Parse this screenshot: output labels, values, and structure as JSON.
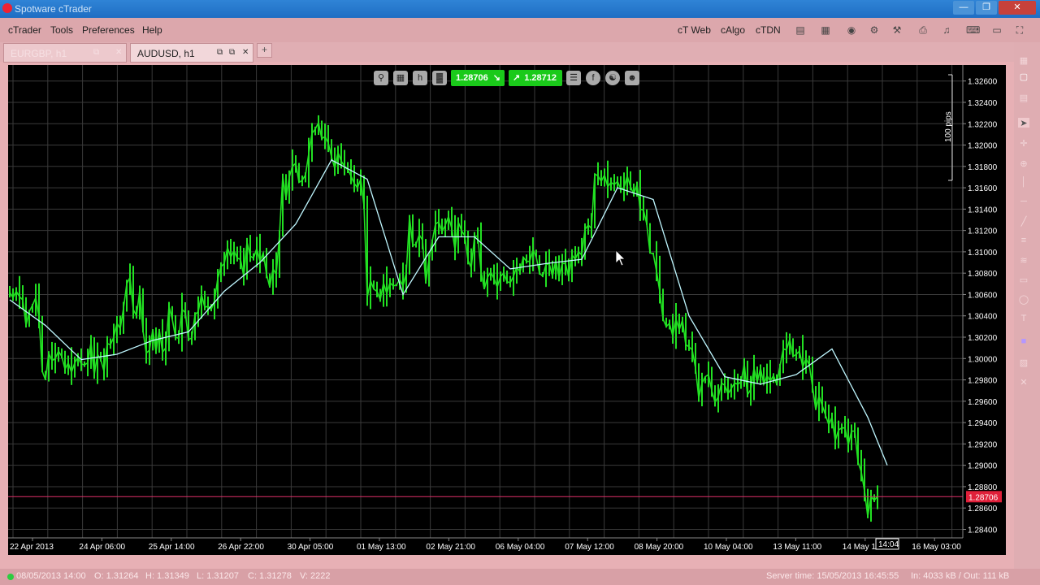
{
  "window": {
    "title": "Spotware cTrader"
  },
  "menu": {
    "items": [
      "cTrader",
      "Tools",
      "Preferences",
      "Help"
    ]
  },
  "toolbar": {
    "links": [
      "cT Web",
      "cAlgo",
      "cTDN"
    ]
  },
  "tabs": [
    {
      "label": "EURGBP, h1",
      "active": false
    },
    {
      "label": "AUDUSD, h1",
      "active": true
    }
  ],
  "chart_toolbar": {
    "timeframe": "h",
    "sell_price": "1.28706",
    "buy_price": "1.28712"
  },
  "chart_data": {
    "type": "line",
    "symbol": "AUDUSD",
    "timeframe": "h1",
    "y_ticks": [
      "1.32600",
      "1.32400",
      "1.32200",
      "1.32000",
      "1.31800",
      "1.31600",
      "1.31400",
      "1.31200",
      "1.31000",
      "1.30800",
      "1.30600",
      "1.30400",
      "1.30200",
      "1.30000",
      "1.29800",
      "1.29600",
      "1.29400",
      "1.29200",
      "1.29000",
      "1.28800",
      "1.28600",
      "1.28400"
    ],
    "ylim": [
      1.2832,
      1.3275
    ],
    "x_ticks": [
      "22 Apr 2013",
      "24 Apr 06:00",
      "25 Apr 14:00",
      "26 Apr 22:00",
      "30 Apr 05:00",
      "01 May 13:00",
      "02 May 21:00",
      "06 May 04:00",
      "07 May 12:00",
      "08 May 20:00",
      "10 May 04:00",
      "13 May 11:00",
      "14 May 19:00",
      "16 May 03:00"
    ],
    "current_price": "1.28706",
    "current_time": "14:04",
    "scale_label": "100 pips",
    "series": [
      {
        "type": "price",
        "x": [
          0,
          1,
          2,
          3,
          4,
          5,
          6,
          7,
          8,
          9,
          10,
          11,
          12,
          13,
          14,
          15,
          16,
          17,
          18,
          19,
          20,
          21,
          22,
          23,
          24,
          25,
          26,
          27,
          28,
          29,
          30,
          31,
          32,
          33,
          34,
          35,
          36,
          37,
          38,
          39,
          40,
          41,
          42,
          43,
          44,
          45,
          46,
          47,
          48,
          49,
          50,
          51,
          52,
          53,
          54,
          55,
          56,
          57,
          58,
          59,
          60,
          61,
          62,
          63,
          64,
          65,
          66,
          67,
          68,
          69,
          70,
          71,
          72,
          73,
          74,
          75,
          76,
          77,
          78,
          79,
          80,
          81,
          82,
          83,
          84,
          85,
          86,
          87,
          88,
          89,
          90,
          91,
          92,
          93,
          94,
          95,
          96,
          97,
          98,
          99,
          100,
          101,
          102,
          103,
          104,
          105,
          106,
          107,
          108,
          109,
          110,
          111,
          112,
          113,
          114,
          115,
          116,
          117,
          118,
          119,
          120,
          121,
          122,
          123,
          124,
          125,
          126,
          127,
          128,
          129,
          130,
          131,
          132,
          133,
          134,
          135,
          136,
          137,
          138,
          139,
          140,
          141,
          142,
          143,
          144,
          145,
          146,
          147,
          148,
          149,
          150,
          151,
          152,
          153,
          154,
          155,
          156,
          157,
          158,
          159,
          160,
          161,
          162,
          163,
          164,
          165,
          166,
          167,
          168,
          169,
          170,
          171,
          172,
          173,
          174,
          175,
          176,
          177,
          178,
          179,
          180,
          181,
          182,
          183,
          184,
          185,
          186,
          187,
          188,
          189,
          190,
          191,
          192,
          193,
          194,
          195,
          196,
          197,
          198,
          199,
          200,
          201,
          202,
          203,
          204,
          205,
          206,
          207,
          208,
          209,
          210,
          211,
          212,
          213,
          214,
          215,
          216,
          217,
          218,
          219,
          220,
          221,
          222,
          223,
          224,
          225,
          226,
          227,
          228,
          229,
          230,
          231,
          232,
          233,
          234,
          235,
          236,
          237,
          238,
          239,
          240,
          241,
          242,
          243,
          244,
          245,
          246,
          247,
          248,
          249,
          250,
          251,
          252,
          253,
          254,
          255,
          256,
          257,
          258,
          259,
          260,
          261,
          262,
          263,
          264,
          265,
          266,
          267,
          268,
          269,
          270
        ],
        "close": [
          1.3062,
          1.3057,
          1.3063,
          1.3058,
          1.3055,
          1.3031,
          1.3044,
          1.305,
          1.3057,
          1.3039,
          1.2988,
          1.298,
          1.3005,
          1.2998,
          1.3,
          1.3007,
          1.3002,
          1.299,
          1.2996,
          1.2987,
          1.2996,
          1.3001,
          1.2995,
          1.2994,
          1.2996,
          1.3015,
          1.2985,
          1.3004,
          1.2999,
          1.2988,
          1.3014,
          1.3013,
          1.302,
          1.3033,
          1.3028,
          1.3047,
          1.307,
          1.3076,
          1.3046,
          1.304,
          1.3064,
          1.3026,
          1.3005,
          1.3008,
          1.3027,
          1.3006,
          1.3027,
          1.3006,
          1.301,
          1.3049,
          1.3037,
          1.302,
          1.3019,
          1.3046,
          1.3043,
          1.3018,
          1.3019,
          1.3041,
          1.3044,
          1.306,
          1.3048,
          1.3049,
          1.3046,
          1.3054,
          1.3075,
          1.3086,
          1.3089,
          1.3104,
          1.3095,
          1.3101,
          1.3094,
          1.3093,
          1.3077,
          1.3109,
          1.3096,
          1.3094,
          1.3103,
          1.3091,
          1.3099,
          1.3079,
          1.3067,
          1.3084,
          1.3079,
          1.3116,
          1.3171,
          1.315,
          1.317,
          1.318,
          1.3183,
          1.3165,
          1.3167,
          1.3172,
          1.3192,
          1.3211,
          1.3215,
          1.3221,
          1.3206,
          1.3208,
          1.3202,
          1.3189,
          1.3178,
          1.3193,
          1.3185,
          1.318,
          1.3177,
          1.3171,
          1.3164,
          1.316,
          1.3168,
          1.3143,
          1.3057,
          1.3073,
          1.3065,
          1.3063,
          1.3055,
          1.3071,
          1.3061,
          1.3071,
          1.3068,
          1.3069,
          1.3074,
          1.3068,
          1.308,
          1.3133,
          1.3106,
          1.3107,
          1.3116,
          1.3111,
          1.3071,
          1.3093,
          1.311,
          1.3126,
          1.3128,
          1.3119,
          1.3125,
          1.3133,
          1.3122,
          1.3102,
          1.3128,
          1.312,
          1.3115,
          1.3092,
          1.3085,
          1.3114,
          1.3115,
          1.3082,
          1.3065,
          1.3076,
          1.3081,
          1.3075,
          1.3067,
          1.3077,
          1.308,
          1.3072,
          1.3071,
          1.3077,
          1.3086,
          1.3081,
          1.3095,
          1.3091,
          1.3091,
          1.3102,
          1.3095,
          1.308,
          1.3077,
          1.3088,
          1.3089,
          1.3077,
          1.3092,
          1.3076,
          1.3089,
          1.3089,
          1.3076,
          1.3097,
          1.3093,
          1.31,
          1.3097,
          1.3121,
          1.3125,
          1.3122,
          1.3173,
          1.3171,
          1.3166,
          1.3172,
          1.3161,
          1.3165,
          1.3163,
          1.3166,
          1.3159,
          1.316,
          1.3171,
          1.3161,
          1.3154,
          1.3163,
          1.314,
          1.3139,
          1.3126,
          1.3099,
          1.3098,
          1.3082,
          1.3063,
          1.3037,
          1.303,
          1.3033,
          1.3021,
          1.3037,
          1.3027,
          1.3036,
          1.3013,
          1.3011,
          1.3008,
          1.2991,
          1.2963,
          1.2977,
          1.2983,
          1.2985,
          1.297,
          1.2959,
          1.2964,
          1.2977,
          1.2975,
          1.2967,
          1.2972,
          1.2977,
          1.2976,
          1.2978,
          1.2995,
          1.2966,
          1.2971,
          1.2991,
          1.2978,
          1.2991,
          1.2976,
          1.2984,
          1.2979,
          1.2984,
          1.2976,
          1.2993,
          1.3009,
          1.3008,
          1.3018,
          1.3002,
          1.3004,
          1.3007,
          1.2992,
          1.3,
          1.2994,
          1.2974,
          1.2952,
          1.2965,
          1.2956,
          1.2947,
          1.2938,
          1.2945,
          1.2923,
          1.2933,
          1.2935,
          1.2935,
          1.2919,
          1.2932,
          1.2932,
          1.2903,
          1.2894,
          1.2876,
          1.2852,
          1.2871,
          1.2867,
          1.2871
        ]
      },
      {
        "type": "moving_average",
        "x": [
          0,
          11,
          22,
          33,
          44,
          55,
          66,
          77,
          88,
          99,
          110,
          121,
          132,
          143,
          154,
          165,
          176,
          187,
          198,
          209,
          220,
          231,
          242,
          253,
          264,
          270
        ],
        "y": [
          1.3055,
          1.3031,
          1.2999,
          1.3004,
          1.3017,
          1.3025,
          1.3063,
          1.309,
          1.3126,
          1.3186,
          1.3168,
          1.306,
          1.3114,
          1.3114,
          1.3084,
          1.3089,
          1.3093,
          1.316,
          1.3149,
          1.304,
          1.2983,
          1.2976,
          1.2985,
          1.3009,
          1.2945,
          1.29
        ]
      }
    ]
  },
  "status": {
    "bar_time": "08/05/2013 14:00",
    "open": "O: 1.31264",
    "high": "H: 1.31349",
    "low": "L: 1.31207",
    "close": "C: 1.31278",
    "volume": "V: 2222",
    "server_time": "Server time: 15/05/2013 16:45:55",
    "traffic": "In: 4033 kB / Out: 111 kB"
  }
}
